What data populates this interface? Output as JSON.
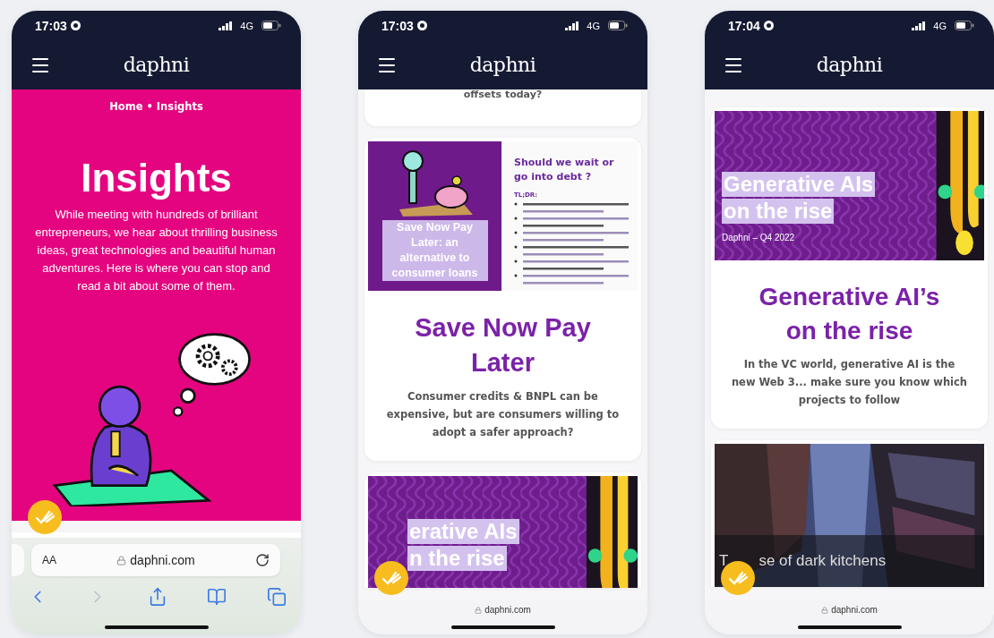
{
  "phones": [
    {
      "status": {
        "time": "17:03",
        "network": "4G"
      },
      "logo": "daphni",
      "content": [
        {
          "kind": "hero",
          "breadcrumb": {
            "home": "Home",
            "separator": "•",
            "current": "Insights"
          },
          "title": "Insights",
          "intro": "While meeting with hundreds of brilliant entrepreneurs, we hear about thrilling business ideas, great technologies and beautiful human adventures. Here is where you can stop and read a bit about some of them."
        }
      ],
      "browser": {
        "kind": "full",
        "text_size": "AA",
        "url": "daphni.com",
        "toolbar": [
          {
            "kind": "back",
            "disabled": false
          },
          {
            "kind": "forward",
            "disabled": true
          },
          {
            "kind": "share",
            "disabled": false
          },
          {
            "kind": "bookmarks",
            "disabled": false
          },
          {
            "kind": "tabs",
            "disabled": false
          }
        ]
      }
    },
    {
      "status": {
        "time": "17:03",
        "network": "4G"
      },
      "logo": "daphni",
      "content": [
        {
          "kind": "card_tail",
          "text": "offsets today?"
        },
        {
          "kind": "article",
          "cover": {
            "kind": "document",
            "heading": "Save Now Pay Later: an alternative to consumer loans",
            "side_title": "Should we wait or go into debt ?",
            "side_label": "TL;DR:"
          },
          "title": "Save Now Pay Later",
          "description": "Consumer credits & BNPL can be expensive, but are consumers willing to adopt a safer approach?"
        },
        {
          "kind": "cover_only",
          "cover": {
            "kind": "banner",
            "lines": [
              "erative AIs",
              "n the rise"
            ]
          }
        }
      ],
      "browser": {
        "kind": "compact",
        "url": "daphni.com"
      }
    },
    {
      "status": {
        "time": "17:04",
        "network": "4G"
      },
      "logo": "daphni",
      "content": [
        {
          "kind": "article",
          "cover": {
            "kind": "banner",
            "lines": [
              "Generative AIs",
              "on the rise"
            ],
            "byline": "Daphni – Q4 2022"
          },
          "title": "Generative AI’s on the rise",
          "description": "In the VC world, generative AI is the new Web 3... make sure you know which projects to follow"
        },
        {
          "kind": "cover_only",
          "cover": {
            "caption": [
              "T",
              "se of dark kitchens"
            ]
          }
        }
      ],
      "browser": {
        "kind": "compact",
        "url": "daphni.com"
      }
    }
  ]
}
